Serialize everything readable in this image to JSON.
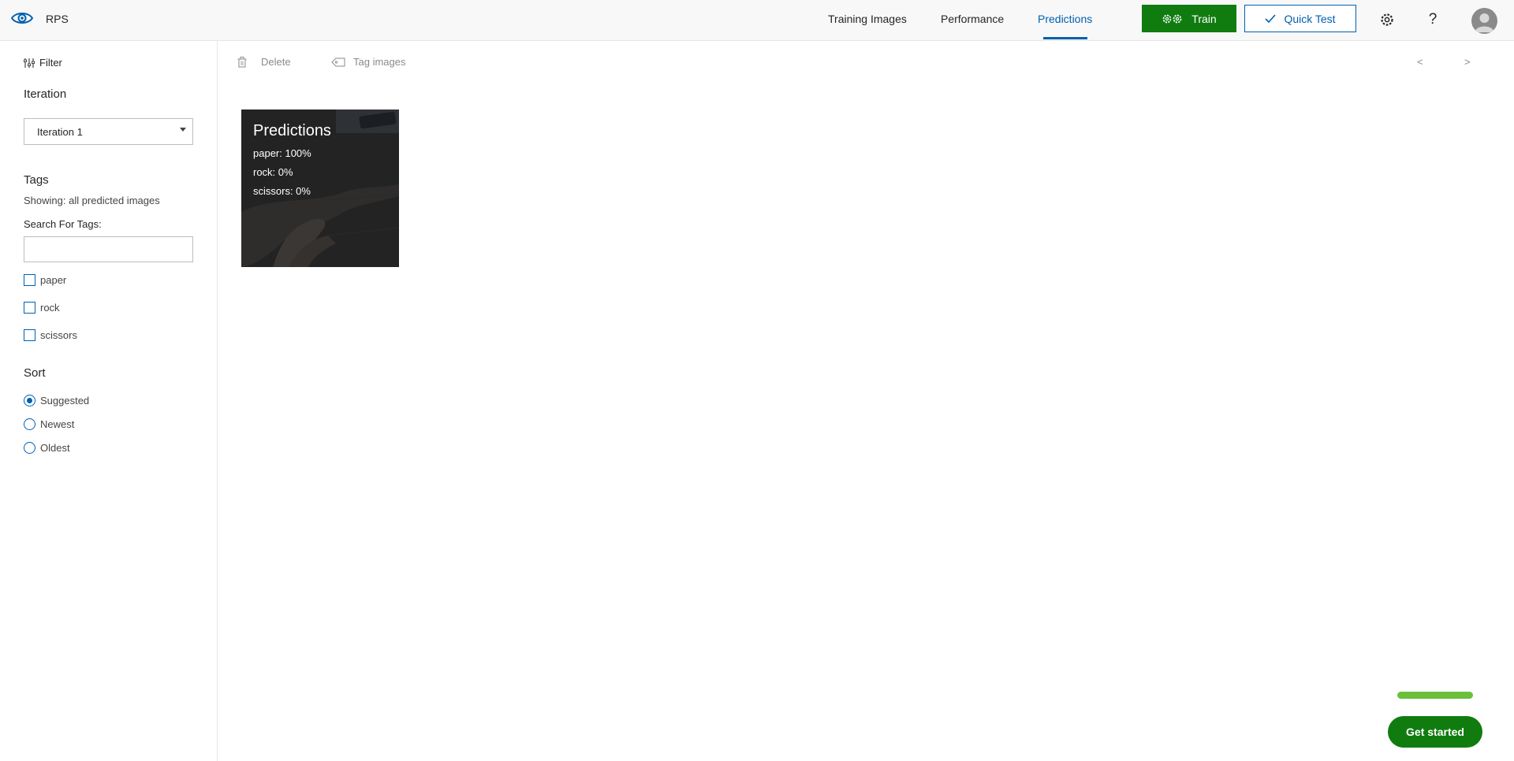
{
  "header": {
    "app_name": "RPS",
    "nav": [
      {
        "label": "Training Images",
        "active": false
      },
      {
        "label": "Performance",
        "active": false
      },
      {
        "label": "Predictions",
        "active": true
      }
    ],
    "train_label": "Train",
    "quick_test_label": "Quick Test",
    "settings_icon": "gear-icon",
    "help_glyph": "?",
    "accent_color": "#0060b0",
    "train_color": "#107c10"
  },
  "sidebar": {
    "filter_label": "Filter",
    "iteration_title": "Iteration",
    "iteration_selected": "Iteration 1",
    "tags_title": "Tags",
    "showing_text": "Showing: all predicted images",
    "search_label": "Search For Tags:",
    "search_value": "",
    "tags": [
      "paper",
      "rock",
      "scissors"
    ],
    "sort_title": "Sort",
    "sort_options": [
      {
        "label": "Suggested",
        "checked": true
      },
      {
        "label": "Newest",
        "checked": false
      },
      {
        "label": "Oldest",
        "checked": false
      }
    ]
  },
  "toolbar": {
    "delete_label": "Delete",
    "tag_images_label": "Tag images",
    "prev_label": "<",
    "next_label": ">"
  },
  "images": [
    {
      "overlay_title": "Predictions",
      "predictions": [
        "paper: 100%",
        "rock: 0%",
        "scissors: 0%"
      ]
    }
  ],
  "get_started": {
    "label": "Get started",
    "progress_color": "#6bbf3a"
  }
}
